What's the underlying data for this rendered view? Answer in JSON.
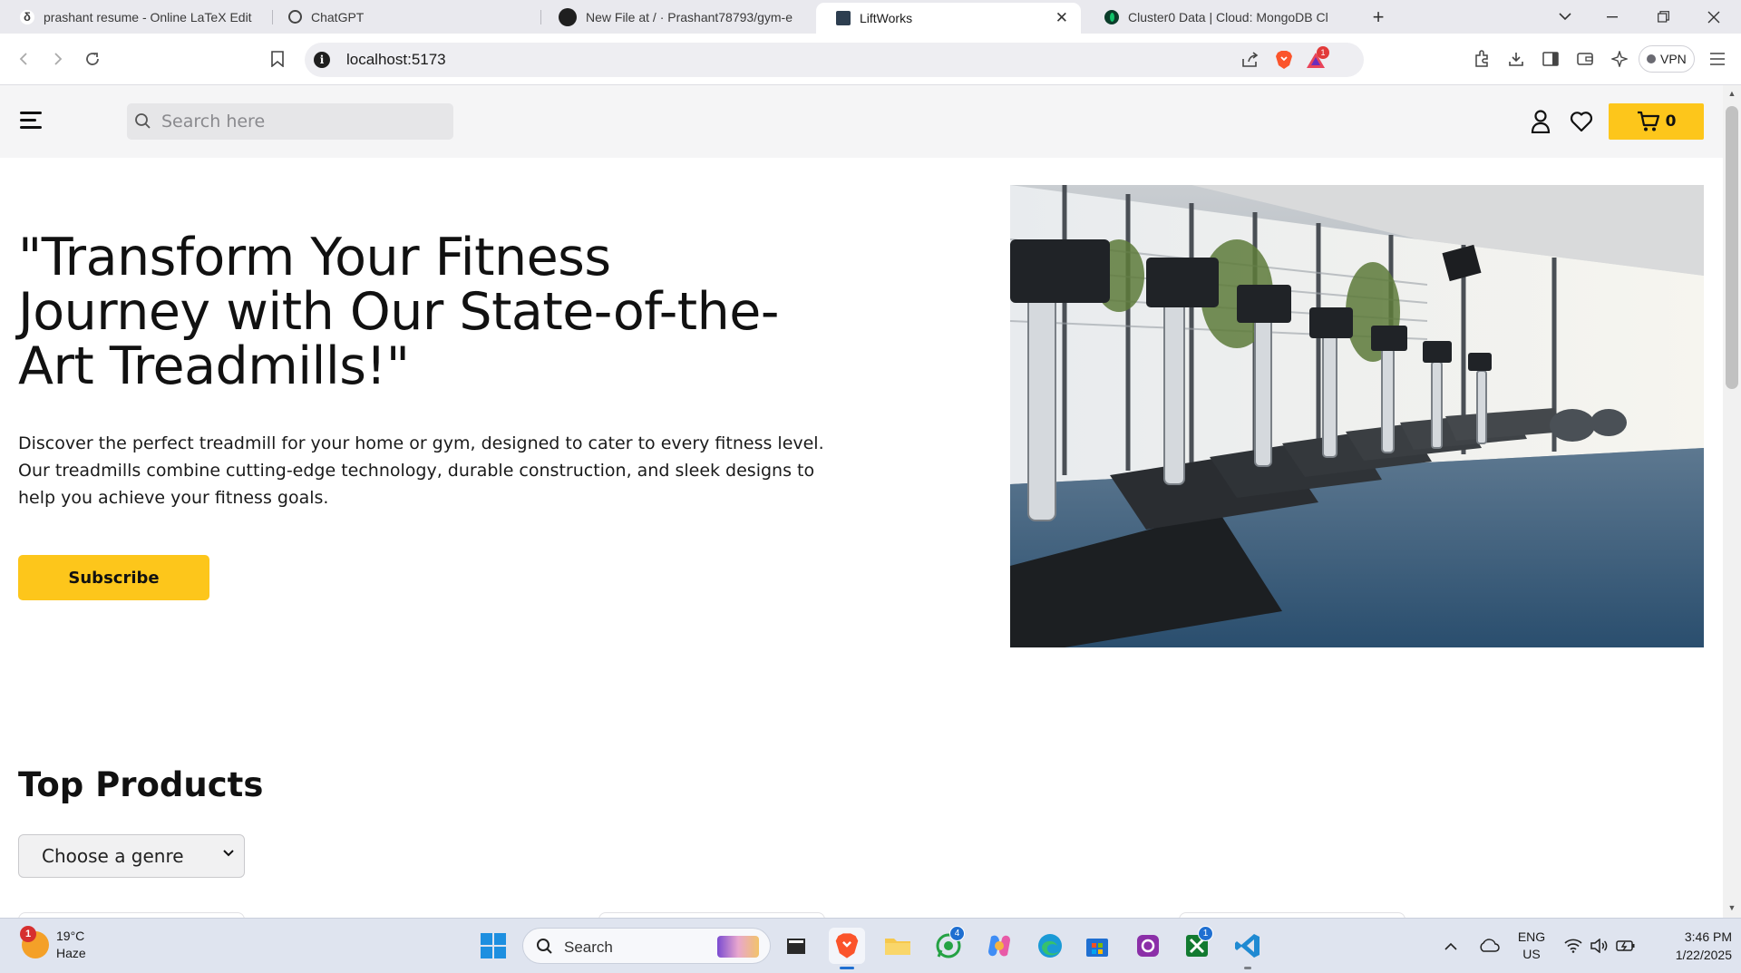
{
  "browser": {
    "tabs": [
      {
        "title": "prashant resume - Online LaTeX Edit",
        "active": false
      },
      {
        "title": "ChatGPT",
        "active": false
      },
      {
        "title": "New File at / · Prashant78793/gym-e",
        "active": false
      },
      {
        "title": "LiftWorks",
        "active": true
      },
      {
        "title": "Cluster0 Data | Cloud: MongoDB Cl",
        "active": false
      }
    ],
    "url": "localhost:5173",
    "alert_badge": "1",
    "vpn_label": "VPN"
  },
  "site": {
    "search_placeholder": "Search here",
    "cart_count": "0",
    "accent_color": "#fdc61b"
  },
  "hero": {
    "title": "\"Transform Your Fitness Journey with Our State-of-the-Art Treadmills!\"",
    "description": "Discover the perfect treadmill for your home or gym, designed to cater to every fitness level. Our treadmills combine cutting-edge technology, durable construction, and sleek designs to help you achieve your fitness goals.",
    "button_label": "Subscribe"
  },
  "products": {
    "section_title": "Top Products",
    "genre_select": "Choose a genre"
  },
  "taskbar": {
    "weather_temp": "19°C",
    "weather_desc": "Haze",
    "weather_badge": "1",
    "search_label": "Search",
    "whatsapp_badge": "4",
    "xbox_badge": "1",
    "lang_top": "ENG",
    "lang_bottom": "US",
    "time": "3:46 PM",
    "date": "1/22/2025"
  }
}
